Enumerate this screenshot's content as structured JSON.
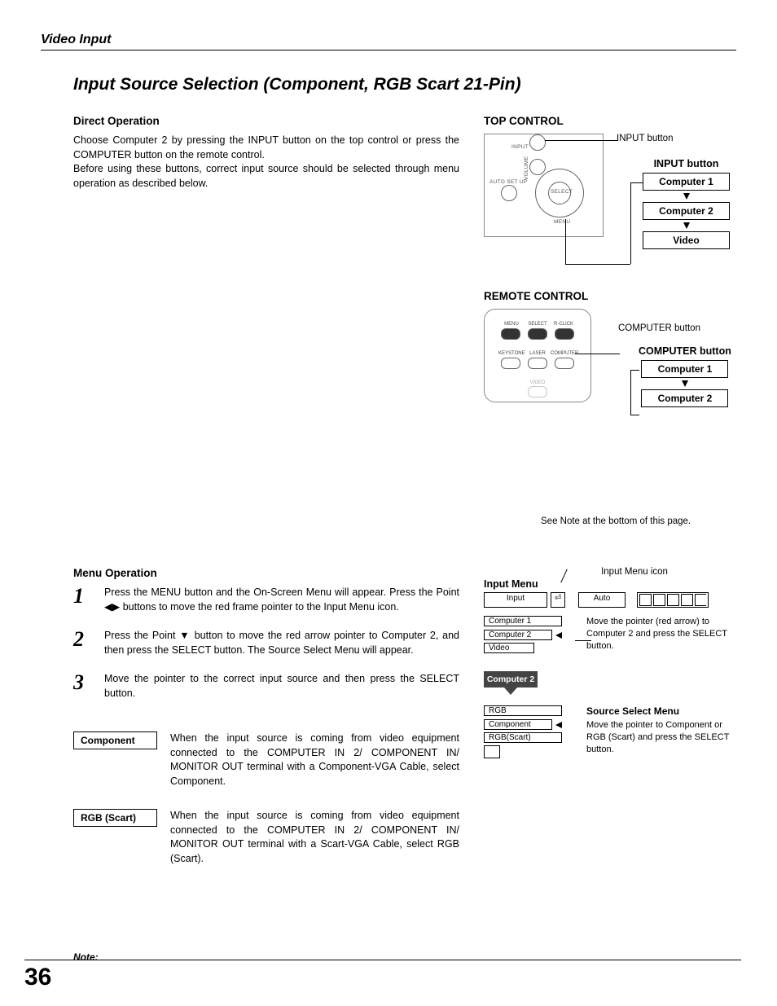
{
  "header": {
    "section": "Video Input"
  },
  "title": "Input Source Selection (Component, RGB Scart 21-Pin)",
  "direct_op": {
    "h": "Direct Operation",
    "p1": "Choose Computer 2 by pressing the INPUT button on the top control or press the COMPUTER button on the remote control.",
    "p2": "Before using these buttons, correct input source should be selected through menu operation as described below."
  },
  "top_ctrl": {
    "h": "TOP CONTROL",
    "labels": {
      "input": "INPUT",
      "autoset": "AUTO SET UP",
      "menu": "MENU",
      "select": "SELECT",
      "volume": "VOLUME"
    },
    "leader": "INPUT button",
    "cycle": {
      "title": "INPUT button",
      "items": [
        "Computer 1",
        "Computer 2",
        "Video"
      ]
    }
  },
  "remote": {
    "h": "REMOTE CONTROL",
    "leader": "COMPUTER button",
    "btns": [
      "MENU",
      "SELECT",
      "R-CLICK",
      "KEYSTONE",
      "LASER",
      "COMPUTER",
      "VIDEO"
    ],
    "cycle": {
      "title": "COMPUTER button",
      "items": [
        "Computer 1",
        "Computer 2"
      ]
    },
    "note": "See Note at the bottom of this page."
  },
  "menu_op": {
    "h": "Menu Operation",
    "steps": [
      "Press the MENU button and the On-Screen Menu will appear.  Press the Point ◀▶ buttons to move the red frame pointer to the Input Menu icon.",
      "Press the Point ▼ button to move the red arrow pointer to Computer 2, and then press the SELECT button.  The Source Select Menu will appear.",
      "Move the pointer to the correct input source and then press the SELECT button."
    ],
    "sources": [
      {
        "label": "Component",
        "txt": "When the input source is coming from video equipment connected to the COMPUTER IN 2/ COMPONENT IN/ MONITOR OUT terminal with a Component-VGA Cable, select Component."
      },
      {
        "label": "RGB (Scart)",
        "txt": "When the input source is coming from video equipment connected to the COMPUTER IN 2/ COMPONENT IN/ MONITOR OUT terminal with a Scart-VGA Cable, select RGB (Scart)."
      }
    ]
  },
  "menu_diag": {
    "icon_label": "Input Menu icon",
    "title": "Input Menu",
    "osd": {
      "input": "Input",
      "auto": "Auto",
      "list": [
        "Computer 1",
        "Computer 2",
        "Video"
      ]
    },
    "tooltip": "Computer 2",
    "cap1": "Move the pointer (red arrow) to Computer 2 and press the SELECT button.",
    "src_title": "Source Select Menu",
    "src_list": [
      "RGB",
      "Component",
      "RGB(Scart)"
    ],
    "cap2": "Move the pointer to Component or RGB (Scart) and press the SELECT button."
  },
  "note_h": "Note:",
  "page_num": "36"
}
